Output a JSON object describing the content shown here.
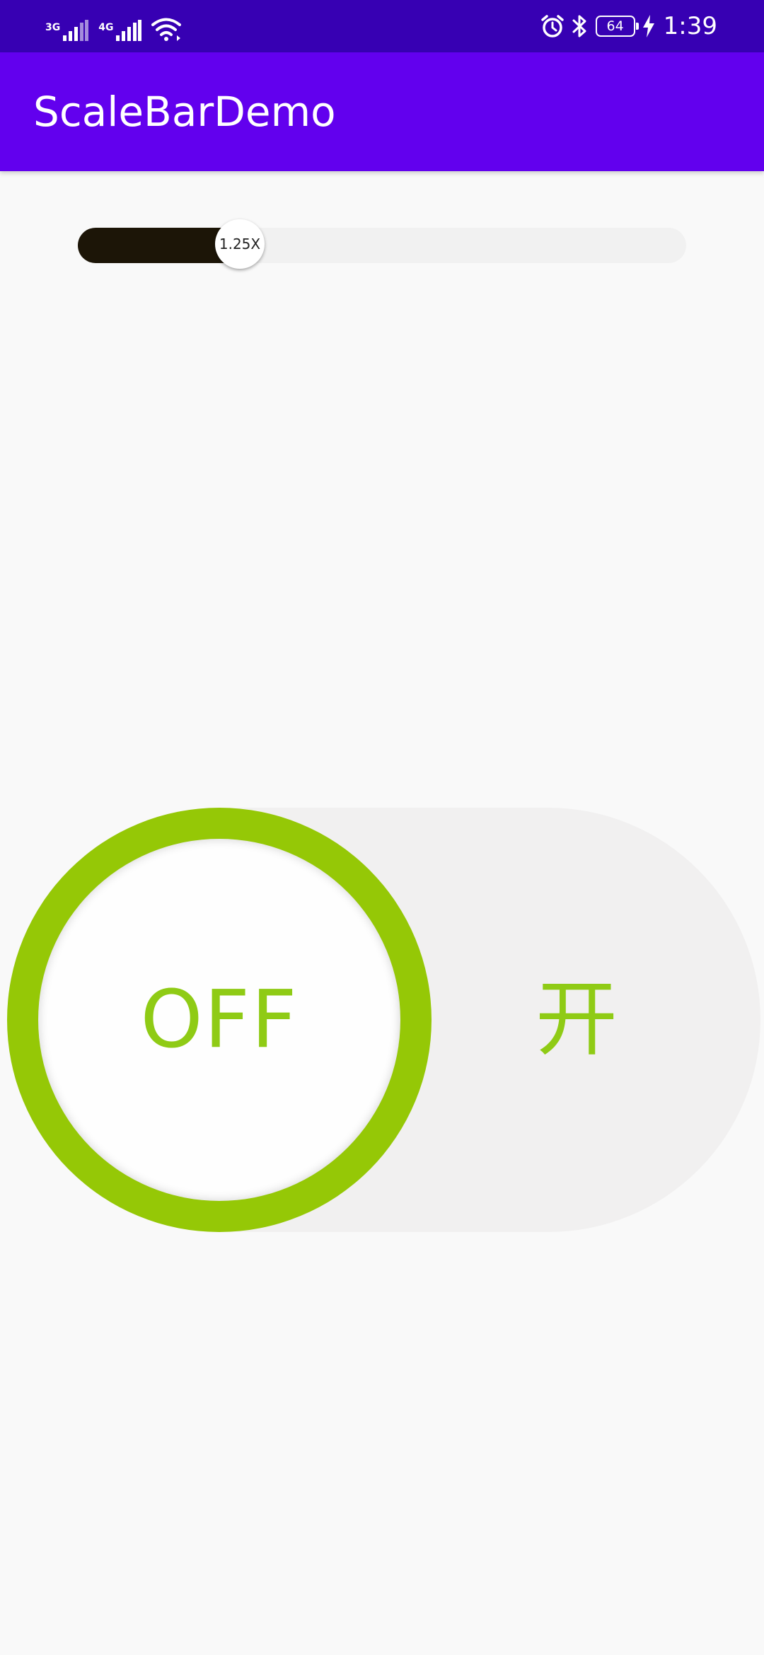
{
  "status_bar": {
    "network_1": "3G",
    "network_2": "4G",
    "battery_level": "64",
    "time": "1:39",
    "icons": [
      "signal-icon",
      "wifi-icon",
      "alarm-icon",
      "bluetooth-icon",
      "battery-icon",
      "charging-icon"
    ]
  },
  "app_bar": {
    "title": "ScaleBarDemo",
    "color": "#6200ee"
  },
  "scale_bar": {
    "value_label": "1.25X",
    "progress_fraction": 0.26,
    "fill_color": "#1c1507"
  },
  "toggle": {
    "state_label": "OFF",
    "on_label": "开",
    "accent_color": "#95c806",
    "checked": false
  }
}
